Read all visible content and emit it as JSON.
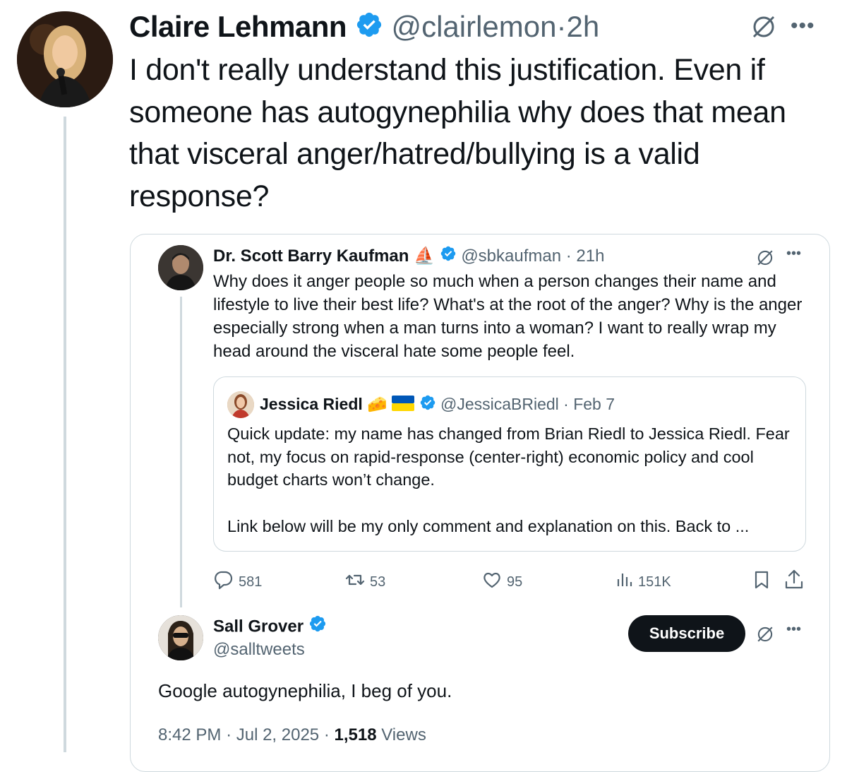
{
  "main_tweet": {
    "author_name": "Claire Lehmann",
    "handle": "@clairlemon",
    "time": "2h",
    "text": "I don't really understand this justification. Even if someone has autogynephilia why does that mean that visceral anger/hatred/bullying is a valid response?"
  },
  "quoted_tweet": {
    "author_name": "Dr. Scott Barry Kaufman",
    "name_emoji": "⛵",
    "handle": "@sbkaufman",
    "time": "21h",
    "text": "Why does it anger people so much when a person changes their name and lifestyle to live their best life? What's at the root of the anger? Why is the anger especially strong when a man turns into a woman? I want to really wrap my head around the visceral hate some people feel.",
    "stats": {
      "replies": "581",
      "reposts": "53",
      "likes": "95",
      "views": "151K"
    },
    "inner_quote": {
      "author_name": "Jessica Riedl",
      "name_emoji": "🧀",
      "handle": "@JessicaBRiedl",
      "time": "Feb 7",
      "text": "Quick update: my name has changed from Brian Riedl to Jessica Riedl. Fear not, my focus on rapid-response (center-right) economic policy and cool budget charts won’t change.",
      "text_2": "Link below will be my only comment and explanation on this. Back to ..."
    }
  },
  "reply_tweet": {
    "author_name": "Sall Grover",
    "handle": "@salltweets",
    "subscribe_label": "Subscribe",
    "text": "Google autogynephilia, I beg of you.",
    "time": "8:42 PM",
    "date": "Jul 2, 2025",
    "views_count": "1,518",
    "views_label": "Views"
  },
  "colors": {
    "verified_blue": "#1d9bf0",
    "text_primary": "#0f1419",
    "text_secondary": "#536471",
    "border": "#cfd9de"
  }
}
